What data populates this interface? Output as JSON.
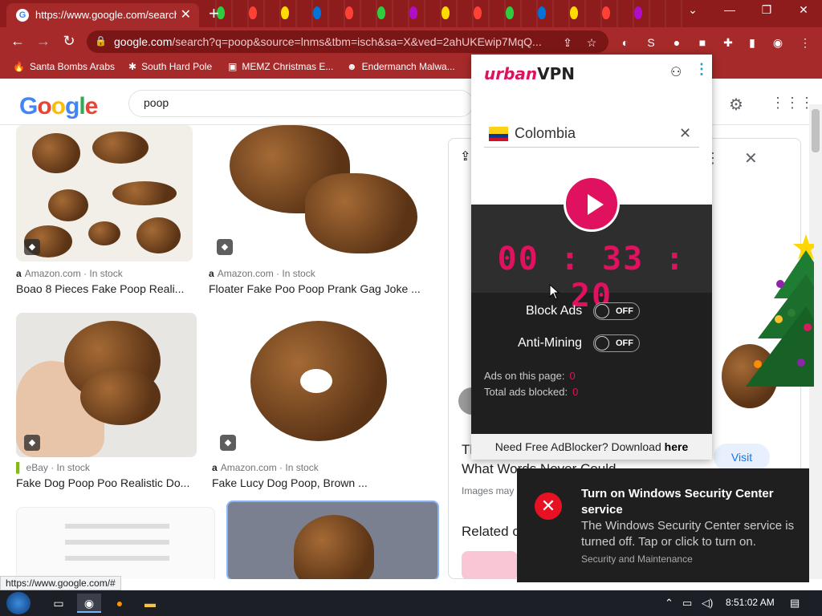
{
  "browser": {
    "tab_title": "https://www.google.com/search?",
    "address_bar": {
      "domain": "google.com",
      "path": "/search?q=poop&source=lnms&tbm=isch&sa=X&ved=2ahUKEwip7MqQ..."
    },
    "bookmarks": [
      {
        "label": "Santa Bombs Arabs"
      },
      {
        "label": "South Hard Pole"
      },
      {
        "label": "MEMZ Christmas E..."
      },
      {
        "label": "Endermanch Malwa..."
      }
    ],
    "status_url": "https://www.google.com/#"
  },
  "google": {
    "search_query": "poop",
    "results": [
      {
        "source": "Amazon.com",
        "stock": " · In stock",
        "title": "Boao 8 Pieces Fake Poop Reali..."
      },
      {
        "source": "Amazon.com",
        "stock": " · In stock",
        "title": "Floater Fake Poo Poop Prank Gag Joke ..."
      },
      {
        "source": "eBay",
        "stock": " · In stock",
        "title": "Fake Dog Poop Poo Realistic Do..."
      },
      {
        "source": "Amazon.com",
        "stock": " · In stock",
        "title": "Fake Lucy Dog Poop, Brown ..."
      }
    ],
    "side_panel": {
      "title_line1": "Th",
      "title_line2": "What Words Never Could",
      "note": "Images may",
      "related": "Related c",
      "visit_label": "Visit"
    }
  },
  "vpn": {
    "logo_brand": "urban",
    "logo_suffix": "VPN",
    "country": "Colombia",
    "timer": "00 : 33 : 20",
    "block_ads_label": "Block Ads",
    "block_ads_state": "OFF",
    "anti_mining_label": "Anti-Mining",
    "anti_mining_state": "OFF",
    "ads_on_page_label": "Ads on this page:",
    "ads_on_page": "0",
    "total_blocked_label": "Total ads blocked:",
    "total_blocked": "0",
    "footer_text": "Need Free AdBlocker? Download ",
    "footer_link": "here"
  },
  "notification": {
    "title": "Turn on Windows Security Center service",
    "body": "The Windows Security Center service is turned off. Tap or click to turn on.",
    "source": "Security and Maintenance"
  },
  "taskbar": {
    "time": "8:51:02 AM"
  },
  "colors": {
    "chrome_red": "#a62a2a",
    "vpn_accent": "#e0115f",
    "toast_error": "#e81123"
  }
}
